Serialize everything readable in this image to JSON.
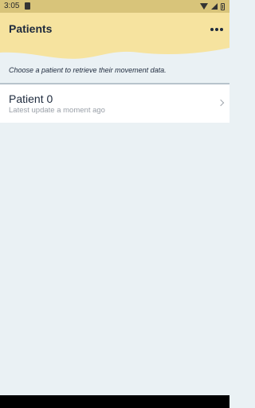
{
  "status_bar": {
    "time": "3:05"
  },
  "app_bar": {
    "title": "Patients",
    "menu_icon": "more-horizontal-icon",
    "background": "#f6e39f"
  },
  "hint_text": "Choose a patient to retrieve their movement data.",
  "patients": [
    {
      "name": "Patient 0",
      "subtitle": "Latest update a moment ago"
    }
  ]
}
